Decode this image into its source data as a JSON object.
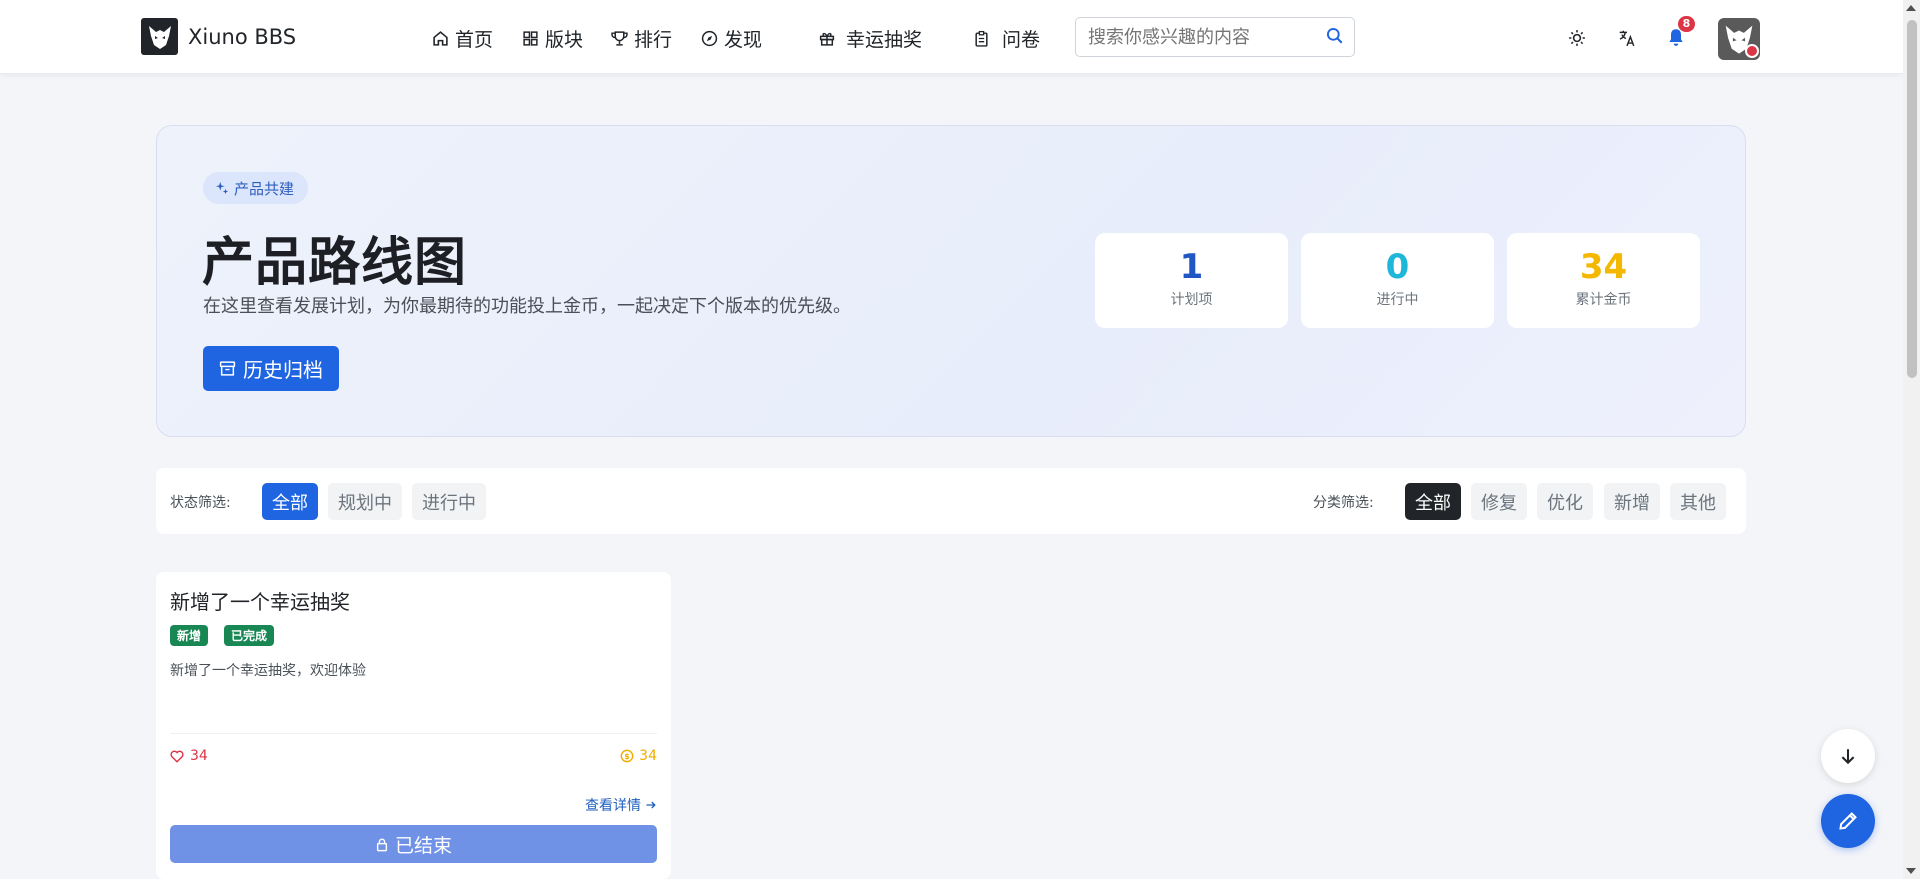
{
  "brand": {
    "name": "Xiuno BBS"
  },
  "nav": {
    "items": [
      {
        "label": "首页",
        "icon": "home-icon"
      },
      {
        "label": "版块",
        "icon": "grid-icon"
      },
      {
        "label": "排行",
        "icon": "trophy-icon"
      },
      {
        "label": "发现",
        "icon": "compass-icon"
      },
      {
        "label": "幸运抽奖",
        "icon": "gift-icon"
      },
      {
        "label": "问卷",
        "icon": "clipboard-icon"
      }
    ]
  },
  "search": {
    "placeholder": "搜索你感兴趣的内容"
  },
  "notifications": {
    "count": "8"
  },
  "hero": {
    "pill": "产品共建",
    "title": "产品路线图",
    "description": "在这里查看发展计划，为你最期待的功能投上金币，一起决定下个版本的优先级。",
    "archive_button": "历史归档",
    "stats": [
      {
        "value": "1",
        "label": "计划项",
        "color": "#2157c4"
      },
      {
        "value": "0",
        "label": "进行中",
        "color": "#1fb6d9"
      },
      {
        "value": "34",
        "label": "累计金币",
        "color": "#f5b800"
      }
    ]
  },
  "filters": {
    "status_label": "状态筛选:",
    "status_options": [
      "全部",
      "规划中",
      "进行中"
    ],
    "status_selected": "全部",
    "category_label": "分类筛选:",
    "category_options": [
      "全部",
      "修复",
      "优化",
      "新增",
      "其他"
    ],
    "category_selected": "全部"
  },
  "cards": [
    {
      "title": "新增了一个幸运抽奖",
      "tags": [
        "新增",
        "已完成"
      ],
      "description": "新增了一个幸运抽奖，欢迎体验",
      "likes": "34",
      "coins": "34",
      "details_link": "查看详情",
      "status_button": "已结束"
    }
  ],
  "colors": {
    "primary": "#1f64e0",
    "success_tag": "#198754",
    "danger": "#dc3545",
    "coin": "#f0ad00"
  }
}
